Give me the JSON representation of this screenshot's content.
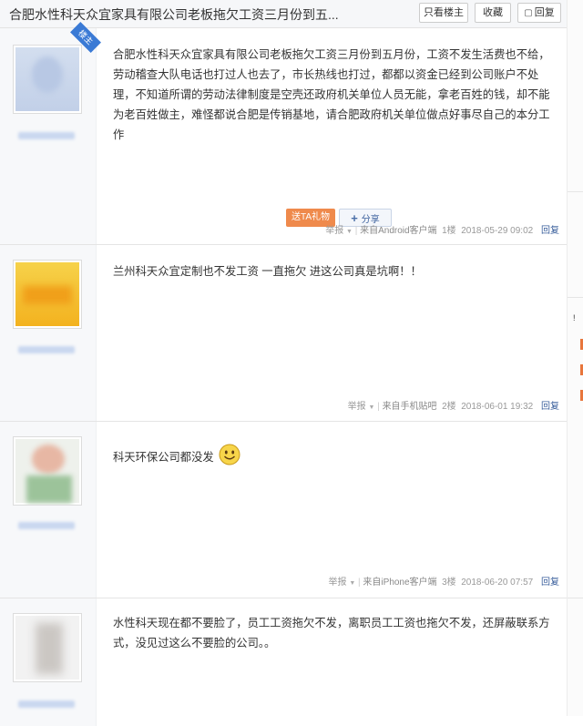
{
  "thread": {
    "title": "合肥水性科天众宜家具有限公司老板拖欠工资三月份到五...",
    "buttons": {
      "only_op": "只看楼主",
      "favorite": "收藏",
      "reply": "回复"
    }
  },
  "posts": [
    {
      "is_op": true,
      "op_badge": "楼主",
      "content": "合肥水性科天众宜家具有限公司老板拖欠工资三月份到五月份，工资不发生活费也不给，劳动稽查大队电话也打过人也去了，市长热线也打过，都都以资金已经到公司账户不处理，不知道所谓的劳动法律制度是空壳还政府机关单位人员无能，拿老百姓的钱，却不能为老百姓做主，难怪都说合肥是传销基地，请合肥政府机关单位做点好事尽自己的本分工作",
      "gift_label": "送TA礼物",
      "share_label": "分享",
      "report": "举报",
      "source": "来自Android客户端",
      "floor": "1楼",
      "time": "2018-05-29 09:02",
      "reply": "回复"
    },
    {
      "content": "兰州科天众宜定制也不发工资 一直拖欠 进这公司真是坑啊！！",
      "report": "举报",
      "source": "来自手机贴吧",
      "floor": "2楼",
      "time": "2018-06-01 19:32",
      "reply": "回复"
    },
    {
      "content": "科天环保公司都没发",
      "emoji": "smiley-face",
      "report": "举报",
      "source": "来自iPhone客户端",
      "floor": "3楼",
      "time": "2018-06-20 07:57",
      "reply": "回复"
    },
    {
      "content": "水性科天现在都不要脸了，员工工资拖欠不发，离职员工工资也拖欠不发，还屏蔽联系方式，没见过这么不要脸的公司。。"
    }
  ],
  "colors": {
    "accent_blue": "#3a7ad5",
    "gift_orange": "#ef8a4c",
    "link_blue": "#3a5f9c",
    "meta_gray": "#999999"
  }
}
